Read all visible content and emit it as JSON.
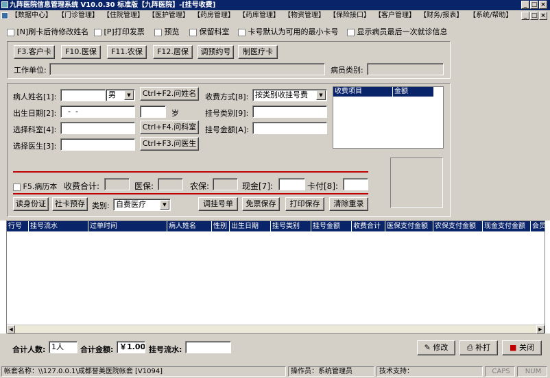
{
  "window": {
    "title": "九阵医院信息管理系统 V10.0.30 标准版【九阵医院】-[挂号收费]",
    "min": "_",
    "max": "□",
    "close": "×"
  },
  "menu": {
    "items": [
      "【数据中心】",
      "【门诊管理】",
      "【住院管理】",
      "【医护管理】",
      "【药房管理】",
      "【药库管理】",
      "【物资管理】",
      "【保险接口】",
      "【客户管理】",
      "【财务/报表】",
      "【系统/帮助】"
    ],
    "child_min": "_",
    "child_max": "□",
    "child_close": "×"
  },
  "options": {
    "items": [
      "[N]刷卡后待修改姓名",
      "[P]打印发票",
      "预览",
      "保留科室",
      "卡号默认为可用的最小卡号",
      "显示病员最后一次就诊信息"
    ]
  },
  "top": {
    "buttons": [
      "F3.客户卡",
      "F10.医保",
      "F11.农保",
      "F12.居保",
      "调预约号",
      "制医疗卡"
    ],
    "work_unit_label": "工作单位:",
    "work_unit_value": "",
    "patient_type_label": "病员类别:",
    "patient_type_value": ""
  },
  "form": {
    "name_label": "病人姓名[1]:",
    "name_value": "",
    "gender_value": "男",
    "birth_label": "出生日期[2]:",
    "birth_value": "  -  -",
    "age_value": "",
    "age_unit": "岁",
    "dept_label": "选择科室[4]:",
    "dept_value": "",
    "doctor_label": "选择医生[3]:",
    "doctor_value": "",
    "btn_ask_name": "Ctrl+F2.问姓名",
    "btn_ask_dept": "Ctrl+F4.问科室",
    "btn_ask_doctor": "Ctrl+F3.问医生",
    "pay_method_label": "收费方式[8]:",
    "pay_method_value": "按类别收挂号费",
    "reg_type_label": "挂号类别[9]:",
    "reg_type_value": "",
    "reg_amount_label": "挂号金额[A]:",
    "reg_amount_value": ""
  },
  "fee_list": {
    "col1": "收费项目",
    "col2": "金额"
  },
  "totals": {
    "history_label": "F5.病历本",
    "fee_total_label": "收费合计:",
    "fee_total_value": "",
    "medical_label": "医保:",
    "medical_value": "",
    "rural_label": "农保:",
    "rural_value": "",
    "cash_label": "现金[7]:",
    "cash_value": "",
    "card_label": "卡付[8]:",
    "card_value": ""
  },
  "actions": {
    "id_card": "读身份证",
    "social_card": "社卡预存",
    "category_label": "类别:",
    "category_value": "自费医疗",
    "adjust": "调挂号单",
    "free_save": "免票保存",
    "print_save": "打印保存",
    "clear": "清除重录"
  },
  "grid": {
    "headers": [
      "行号",
      "挂号流水",
      "过单时间",
      "病人姓名",
      "性别",
      "出生日期",
      "挂号类别",
      "挂号金额",
      "收费合计",
      "医保支付金额",
      "农保支付金额",
      "现金支付金额",
      "会员"
    ]
  },
  "footer": {
    "count_label": "合计人数:",
    "count_value": "1人",
    "amount_label": "合计金额:",
    "amount_value": "￥1.00",
    "serial_label": "挂号流水:",
    "serial_value": "",
    "edit": "修改",
    "reprint": "补打",
    "close": "关闭"
  },
  "status": {
    "account": "帐套名称：\\\\127.0.0.1\\成都誉美医院帐套 [V1094]",
    "operator": "操作员：系统管理员",
    "support": "技术支持：",
    "caps": "CAPS",
    "num": "NUM"
  },
  "colors": {
    "title_bg": "#0a246a",
    "face": "#d4d0c8",
    "accent_red": "#c00000"
  }
}
